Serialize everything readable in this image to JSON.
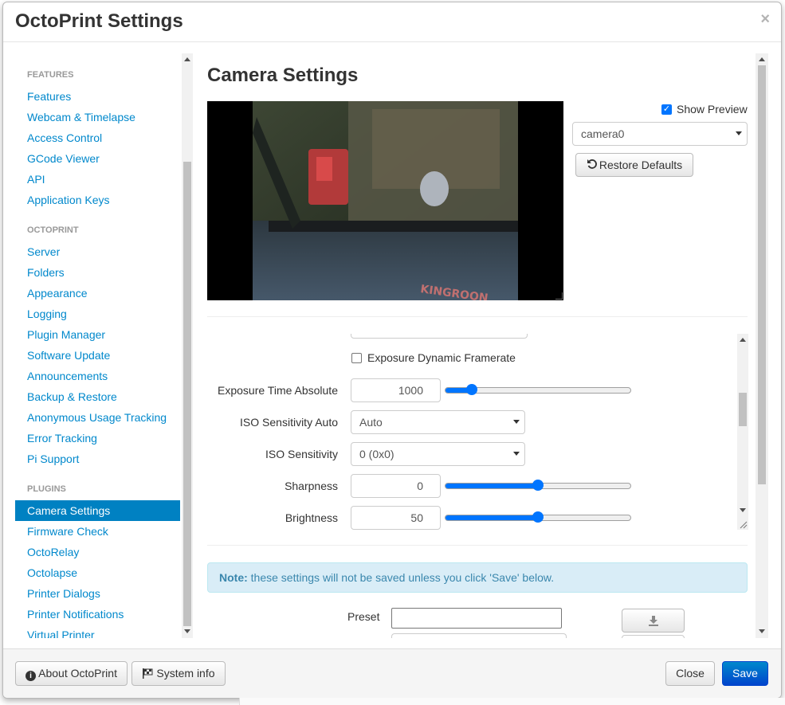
{
  "modal": {
    "title": "OctoPrint Settings",
    "close_symbol": "×"
  },
  "sidebar": {
    "sections": [
      {
        "header": "FEATURES",
        "items": [
          "Features",
          "Webcam & Timelapse",
          "Access Control",
          "GCode Viewer",
          "API",
          "Application Keys"
        ]
      },
      {
        "header": "OCTOPRINT",
        "items": [
          "Server",
          "Folders",
          "Appearance",
          "Logging",
          "Plugin Manager",
          "Software Update",
          "Announcements",
          "Backup & Restore",
          "Anonymous Usage Tracking",
          "Error Tracking",
          "Pi Support"
        ]
      },
      {
        "header": "PLUGINS",
        "items": [
          "Camera Settings",
          "Firmware Check",
          "OctoRelay",
          "Octolapse",
          "Printer Dialogs",
          "Printer Notifications",
          "Virtual Printer"
        ]
      }
    ],
    "active_item": "Camera Settings"
  },
  "camera": {
    "title": "Camera Settings",
    "show_preview_label": "Show Preview",
    "show_preview_checked": true,
    "camera_select": "camera0",
    "restore_defaults_label": "Restore Defaults",
    "exposure_dynamic_framerate_label": "Exposure Dynamic Framerate",
    "exposure_dynamic_framerate_checked": false,
    "controls": [
      {
        "label": "Exposure Time Absolute",
        "value": "1000",
        "slider_fraction": 0.12
      },
      {
        "label": "ISO Sensitivity Auto",
        "select": "Auto"
      },
      {
        "label": "ISO Sensitivity",
        "select": "0 (0x0)"
      },
      {
        "label": "Sharpness",
        "value": "0",
        "slider_fraction": 0.5
      },
      {
        "label": "Brightness",
        "value": "50",
        "slider_fraction": 0.5
      }
    ],
    "note_bold": "Note:",
    "note_text": " these settings will not be saved unless you click 'Save' below.",
    "preset_label": "Preset",
    "preset_value": ""
  },
  "footer": {
    "about_label": "About OctoPrint",
    "sysinfo_label": "System info",
    "close_label": "Close",
    "save_label": "Save"
  },
  "colors": {
    "accent": "#0081c2",
    "link": "#0088cc",
    "save": "#0069d9",
    "note_bg": "#d9edf7"
  }
}
